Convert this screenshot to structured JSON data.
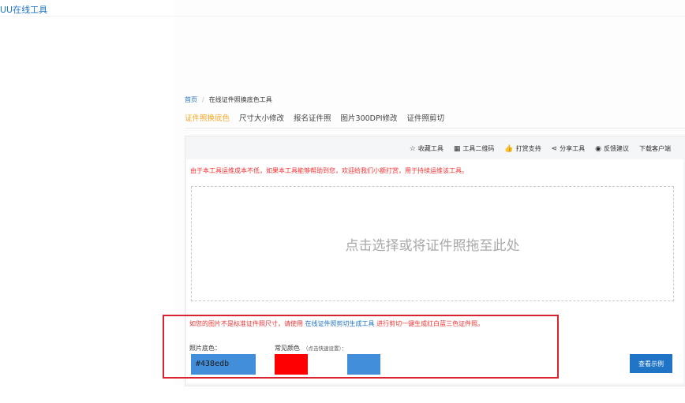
{
  "site": {
    "title": "UU在线工具"
  },
  "breadcrumb": {
    "home": "首页",
    "separator": "/",
    "current": "在线证件照换底色工具"
  },
  "tabs": [
    {
      "label": "证件照换底色",
      "active": true
    },
    {
      "label": "尺寸大小修改",
      "active": false
    },
    {
      "label": "报名证件照",
      "active": false
    },
    {
      "label": "图片300DPI修改",
      "active": false
    },
    {
      "label": "证件照剪切",
      "active": false
    }
  ],
  "toolbar": [
    {
      "icon": "star-icon",
      "glyph": "☆",
      "label": "收藏工具"
    },
    {
      "icon": "qrcode-icon",
      "glyph": "▦",
      "label": "工具二维码"
    },
    {
      "icon": "thumbs-up-icon",
      "glyph": "👍",
      "label": "打赏支持"
    },
    {
      "icon": "share-icon",
      "glyph": "⋖",
      "label": "分享工具"
    },
    {
      "icon": "feedback-icon",
      "glyph": "◉",
      "label": "反馈建议"
    },
    {
      "icon": "",
      "glyph": "",
      "label": "下载客户端"
    }
  ],
  "notice": "由于本工具运维成本不低，如果本工具能够帮助到您，欢迎给我们小额打赏，用于持续运维该工具。",
  "dropzone": {
    "text": "点击选择或将证件照拖至此处"
  },
  "hint": {
    "prefix": "如您的图片不是标准证件照尺寸，请使用",
    "link": "在线证件照剪切生成工具",
    "suffix": "进行剪切一键生成红白蓝三色证件照。"
  },
  "background_color": {
    "label": "照片底色：",
    "value": "#438edb"
  },
  "common_colors": {
    "label": "常见颜色",
    "sublabel": "（点击快速设置）：",
    "swatches": [
      "#ff0000",
      "#438edb"
    ]
  },
  "example_button": {
    "label": "查看示例"
  },
  "colors": {
    "accent": "#1f74c6",
    "active_tab": "#f5a623",
    "warning": "#e33333",
    "highlight": "#d9232f"
  }
}
